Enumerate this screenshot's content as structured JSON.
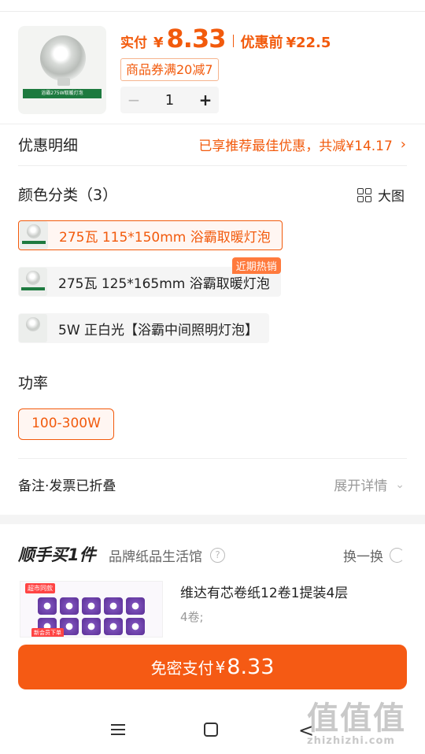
{
  "product": {
    "image_caption": "浴霸275W取暖灯泡",
    "price_label": "实付",
    "currency": "¥",
    "price": "8.33",
    "price_before_label": "优惠前",
    "price_before": "¥22.5",
    "coupon": "商品券满20减7",
    "quantity": "1",
    "minus": "−",
    "plus": "+"
  },
  "discount": {
    "label": "优惠明细",
    "detail": "已享推荐最佳优惠，共减¥14.17",
    "chevron": "›"
  },
  "color": {
    "label": "颜色分类（3）",
    "big_view": "大图",
    "options": [
      {
        "label": "275瓦 115*150mm 浴霸取暖灯泡",
        "selected": true
      },
      {
        "label": "275瓦 125*165mm 浴霸取暖灯泡",
        "tag": "近期热销"
      },
      {
        "label": "5W  正白光【浴霸中间照明灯泡】"
      }
    ]
  },
  "power": {
    "label": "功率",
    "option": "100-300W"
  },
  "notes": {
    "label": "备注·发票已折叠",
    "expand": "展开详情",
    "chevron": "⌄"
  },
  "addon": {
    "title": "顺手买1件",
    "store": "品牌纸品生活馆",
    "help": "?",
    "refresh": "换一换",
    "img_tag1": "超市同款",
    "img_tag2": "新会员下单",
    "item_name": "维达有芯卷纸12卷1提装4层",
    "item_spec": "4卷;"
  },
  "pay": {
    "label": "免密支付",
    "currency": "¥",
    "amount": "8.33"
  },
  "nav": {
    "back": "<"
  },
  "watermark": {
    "glyphs": "值值值",
    "url": "zhizhizhi.com"
  },
  "colors": {
    "accent": "#f25a0c",
    "pay_button": "#f55a14",
    "hot_tag": "#ff7a3d"
  }
}
